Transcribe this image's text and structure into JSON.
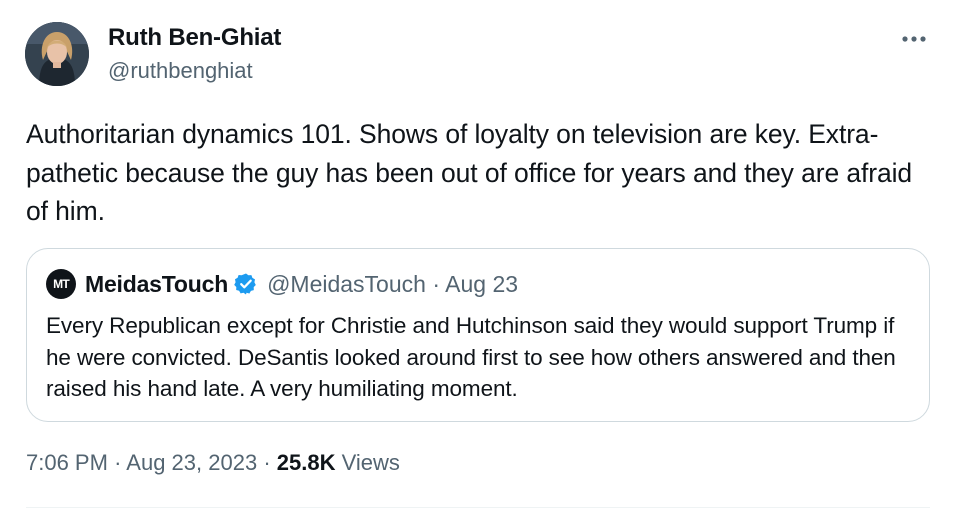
{
  "author": {
    "name": "Ruth Ben-Ghiat",
    "handle": "@ruthbenghiat"
  },
  "more_icon": "more-horizontal-icon",
  "tweet_text": "Authoritarian dynamics 101. Shows of loyalty on television are key. Extra-pathetic because the guy has been out of office for years and they are afraid of him.",
  "quote": {
    "avatar_text": "MT",
    "name": "MeidasTouch",
    "verified": true,
    "verified_color": "#1d9bf0",
    "handle": "@MeidasTouch",
    "separator": "·",
    "date": "Aug 23",
    "text": "Every Republican except for Christie and Hutchinson said they would support Trump if he were convicted. DeSantis looked around first to see how others answered and then raised his hand late. A very humiliating moment."
  },
  "meta": {
    "time": "7:06 PM",
    "separator": "·",
    "date": "Aug 23, 2023",
    "views_count": "25.8K",
    "views_label": "Views"
  },
  "colors": {
    "text": "#0f1419",
    "secondary": "#536471",
    "border": "#cfd9de"
  }
}
